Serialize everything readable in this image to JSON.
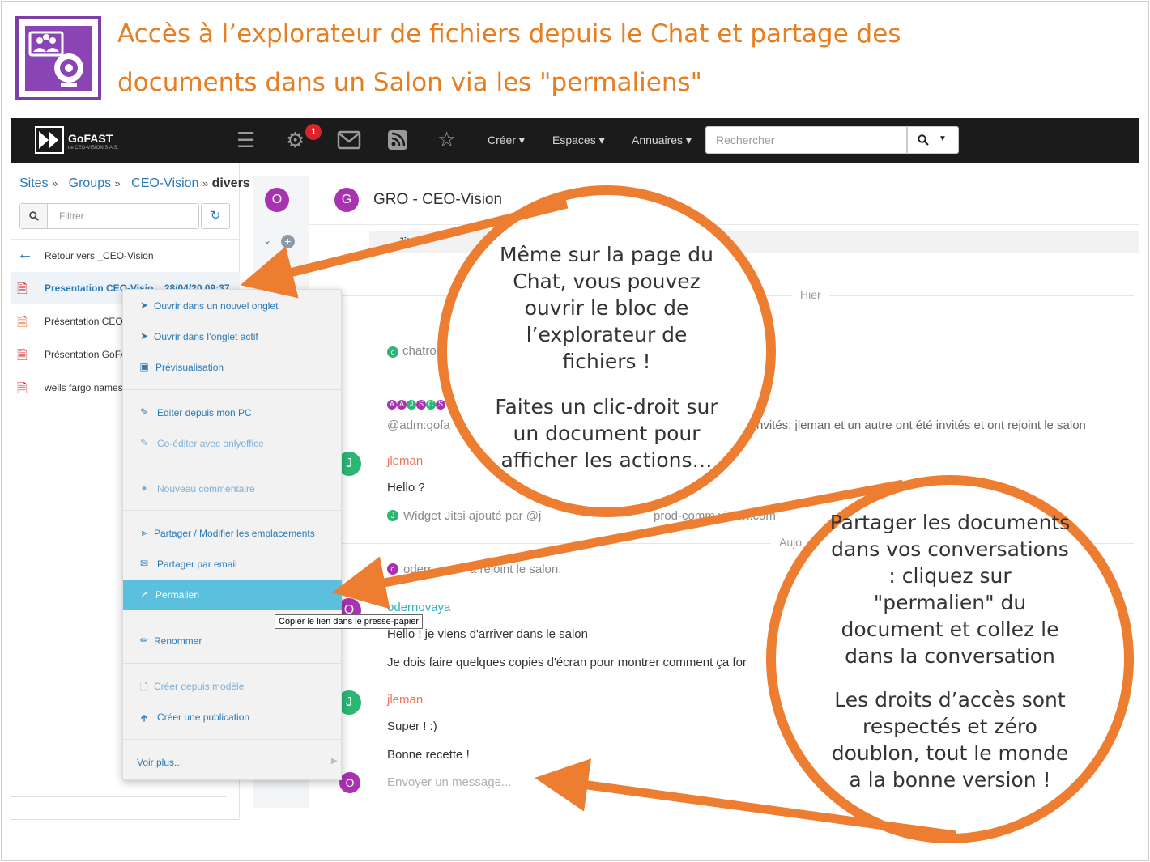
{
  "slide": {
    "title_line1": "Accès à l’explorateur de fichiers depuis le Chat et partage des",
    "title_line2": "documents dans un Salon via les \"permaliens\"",
    "accent_color": "#ed7d31",
    "logo_icon": "video-meeting-icon"
  },
  "navbar": {
    "brand": "GoFAST",
    "brand_sub": "de CEO-VISION S.A.S.",
    "notification_count": "1",
    "menus": [
      "Créer",
      "Espaces",
      "Annuaires"
    ],
    "search_placeholder": "Rechercher",
    "icons": [
      "hamburger-icon",
      "gear-icon",
      "mail-icon",
      "rss-icon",
      "star-icon",
      "search-icon"
    ]
  },
  "file_browser": {
    "breadcrumb": {
      "sites": "Sites",
      "sep": "»",
      "groups": "_Groups",
      "ceo": "_CEO-Vision",
      "current": "divers"
    },
    "filter_placeholder": "Filtrer",
    "back_label": "Retour vers _CEO-Vision",
    "files": [
      {
        "name": "Presentation CEO-Visio...  28/04/20 09:37",
        "type": "pdf"
      },
      {
        "name": "Présentation CEO-",
        "type": "ppt"
      },
      {
        "name": "Présentation GoFA",
        "type": "pdf"
      },
      {
        "name": "wells fargo names",
        "type": "pdf"
      }
    ]
  },
  "context_menu": {
    "open_new_tab": "Ouvrir dans un nouvel onglet",
    "open_active_tab": "Ouvrir dans l’onglet actif",
    "preview": "Prévisualisation",
    "edit_pc": "Editer depuis mon PC",
    "coedit": "Co-éditer avec onlyoffice",
    "new_comment": "Nouveau commentaire",
    "share": "Partager / Modifier les emplacements",
    "share_email": "Partager par email",
    "permalink": "Permalien",
    "rename": "Renommer",
    "create_from_template": "Créer depuis modèle",
    "create_publication": "Créer une publication",
    "see_more": "Voir plus...",
    "tooltip": "Copier le lien dans le presse-papier"
  },
  "chat": {
    "channel_avatar": "O",
    "room_avatar": "G",
    "room_title": "GRO - CEO-Vision",
    "jitsi_label": "Jitsi",
    "day_yesterday": "Hier",
    "day_today": "Aujo",
    "chatro": "chatro",
    "avatars_row": "A A J S C S",
    "adm_line_left": "@adm:gofa",
    "adm_line_right": "nvités, jleman et un autre ont été invités et ont rejoint le salon",
    "user_jleman": "jleman",
    "msg_hello": "Hello ?",
    "widget_left": "Widget Jitsi ajouté par @j",
    "widget_right": "prod-comm        vision.com",
    "joined_left": "oderr",
    "joined_right": "a rejoint le salon.",
    "user_odernovaya": "odernovaya",
    "msg_hello2": "Hello ! je viens d'arriver dans le salon",
    "msg_copies": "Je dois faire quelques copies d'écran pour montrer comment ça for",
    "msg_super": "Super ! :)",
    "msg_recette": "Bonne recette !",
    "composer_placeholder": "Envoyer un message..."
  },
  "callouts": {
    "bubble1_p1": "Même sur la page du Chat, vous pouvez ouvrir le bloc de l’explorateur de fichiers !",
    "bubble1_p2": "Faites un clic-droit sur un document pour afficher les actions…",
    "bubble2_p1": "Partager les documents dans vos conversations : cliquez sur \"permalien\" du document et collez le dans la conversation",
    "bubble2_p2": "Les droits d’accès sont respectés et zéro doublon, tout le monde a la bonne version !"
  }
}
